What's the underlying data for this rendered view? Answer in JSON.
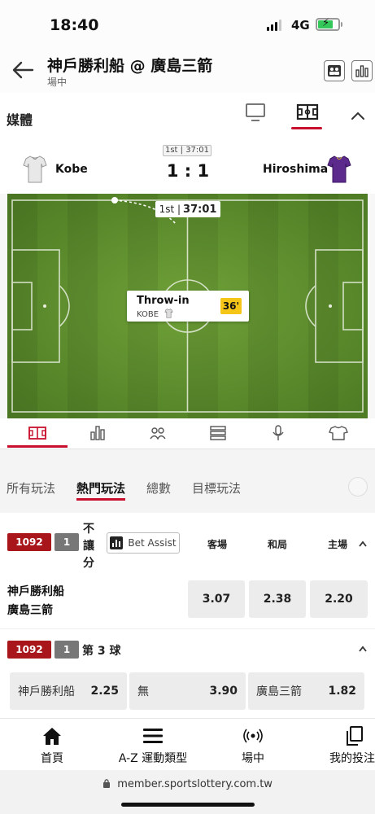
{
  "status_bar": {
    "time": "18:40",
    "network": "4G",
    "battery_color": "#34c759"
  },
  "header": {
    "title": "神戶勝利船 @ 廣島三箭",
    "status": "場中",
    "back_icon": "arrow-left-icon"
  },
  "media": {
    "title": "媒體",
    "accent": "#c8102e"
  },
  "match": {
    "period_badge": "1st | 37:01",
    "home_team": "Kobe",
    "away_team": "Hiroshima",
    "score": "1 : 1"
  },
  "pitch": {
    "timer_period": "1st |",
    "timer_clock": "37:01",
    "event": {
      "title": "Throw-in",
      "team": "KOBE",
      "minute": "36'"
    },
    "grass_color": "#5a8a2c"
  },
  "market_tabs": [
    {
      "label": "所有玩法",
      "active": false
    },
    {
      "label": "熱門玩法",
      "active": true
    },
    {
      "label": "總數",
      "active": false
    },
    {
      "label": "目標玩法",
      "active": false
    }
  ],
  "market1": {
    "id": "1092",
    "line": "1",
    "name_chars": [
      "不",
      "讓",
      "分"
    ],
    "bet_assist": "Bet Assist",
    "columns": [
      "客場",
      "和局",
      "主場"
    ],
    "teams": [
      "神戶勝利船",
      "廣島三箭"
    ],
    "odds": [
      "3.07",
      "2.38",
      "2.20"
    ]
  },
  "market2": {
    "id": "1092",
    "line": "1",
    "name": "第 3 球",
    "options": [
      {
        "label": "神戶勝利船",
        "odd": "2.25"
      },
      {
        "label": "無",
        "odd": "3.90"
      },
      {
        "label": "廣島三箭",
        "odd": "1.82"
      }
    ]
  },
  "bottom_nav": [
    {
      "label": "首頁",
      "icon": "home-icon"
    },
    {
      "label": "A-Z 運動類型",
      "icon": "menu-icon"
    },
    {
      "label": "場中",
      "icon": "live-signal-icon"
    },
    {
      "label": "我的投注",
      "icon": "documents-icon"
    }
  ],
  "browser": {
    "url": "member.sportslottery.com.tw"
  }
}
